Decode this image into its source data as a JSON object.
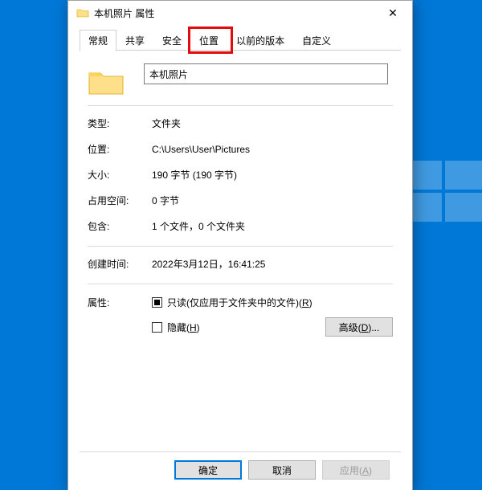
{
  "dialog": {
    "title": "本机照片 属性",
    "close_glyph": "✕"
  },
  "tabs": {
    "general": "常规",
    "sharing": "共享",
    "security": "安全",
    "location": "位置",
    "previous": "以前的版本",
    "customize": "自定义"
  },
  "name_field": {
    "value": "本机照片"
  },
  "fields": {
    "type_label": "类型:",
    "type_value": "文件夹",
    "location_label": "位置:",
    "location_value": "C:\\Users\\User\\Pictures",
    "size_label": "大小:",
    "size_value": "190 字节 (190 字节)",
    "sizeondisk_label": "占用空间:",
    "sizeondisk_value": "0 字节",
    "contains_label": "包含:",
    "contains_value": "1 个文件，0 个文件夹",
    "created_label": "创建时间:",
    "created_value": "2022年3月12日，16:41:25"
  },
  "attributes": {
    "label": "属性:",
    "readonly_text": "只读(仅应用于文件夹中的文件)(",
    "readonly_hotkey": "R",
    "readonly_tail": ")",
    "hidden_text": "隐藏(",
    "hidden_hotkey": "H",
    "hidden_tail": ")",
    "advanced_text": "高级(",
    "advanced_hotkey": "D",
    "advanced_tail": ")..."
  },
  "buttons": {
    "ok": "确定",
    "cancel": "取消",
    "apply_text": "应用(",
    "apply_hotkey": "A",
    "apply_tail": ")"
  }
}
